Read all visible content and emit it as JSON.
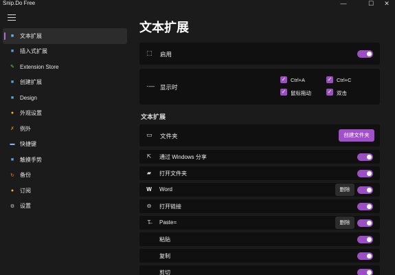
{
  "window": {
    "title": "Snip.Do Free",
    "minimize": "—",
    "maximize": "☐",
    "close": "✕"
  },
  "sidebar": {
    "items": [
      {
        "label": "文本扩展",
        "icon": "text-expand-icon",
        "color": "#6fb3e8",
        "glyph": "■"
      },
      {
        "label": "插入式扩展",
        "icon": "insert-expand-icon",
        "color": "#5aa0e0",
        "glyph": "■"
      },
      {
        "label": "Extension Store",
        "icon": "store-icon",
        "color": "#7ac943",
        "glyph": "✎"
      },
      {
        "label": "创建扩展",
        "icon": "create-expand-icon",
        "color": "#5aa0e0",
        "glyph": "■"
      },
      {
        "label": "Design",
        "icon": "design-icon",
        "color": "#5aa0e0",
        "glyph": "■"
      },
      {
        "label": "外观设置",
        "icon": "appearance-icon",
        "color": "#f0b429",
        "glyph": "●"
      },
      {
        "label": "例外",
        "icon": "exception-icon",
        "color": "#f07a29",
        "glyph": "✗"
      },
      {
        "label": "快捷键",
        "icon": "keyboard-icon",
        "color": "#8ab4e8",
        "glyph": "▬"
      },
      {
        "label": "触摸手势",
        "icon": "gesture-icon",
        "color": "#5aa0e0",
        "glyph": "■"
      },
      {
        "label": "备份",
        "icon": "backup-icon",
        "color": "#f07a29",
        "glyph": "↻"
      },
      {
        "label": "订阅",
        "icon": "subscribe-icon",
        "color": "#f0b429",
        "glyph": "●"
      },
      {
        "label": "设置",
        "icon": "settings-icon",
        "color": "#cccccc",
        "glyph": "⚙"
      }
    ]
  },
  "main": {
    "title": "文本扩展",
    "enable": {
      "label": "启用",
      "on": true
    },
    "display": {
      "label": "显示时",
      "options": [
        {
          "label": "Ctrl+A",
          "checked": true
        },
        {
          "label": "Ctrl+C",
          "checked": true
        },
        {
          "label": "鼠标拖动",
          "checked": true
        },
        {
          "label": "双击",
          "checked": true
        }
      ]
    },
    "section_title": "文本扩展",
    "folder": {
      "label": "文件夹",
      "create_label": "创建文件夹"
    },
    "extensions": [
      {
        "label": "通过 Windows 分享",
        "icon": "share-icon",
        "glyph": "⇱",
        "delete": false,
        "on": true
      },
      {
        "label": "打开文件夹",
        "icon": "folder-icon",
        "glyph": "▰",
        "delete": false,
        "on": true
      },
      {
        "label": "Word",
        "icon": "word-icon",
        "glyph": "W",
        "delete": true,
        "on": true
      },
      {
        "label": "打开链接",
        "icon": "link-icon",
        "glyph": "⊖",
        "delete": false,
        "on": true
      },
      {
        "label": "Paste=",
        "icon": "paste-format-icon",
        "glyph": "T̶",
        "delete": true,
        "on": true
      },
      {
        "label": "粘贴",
        "icon": "",
        "glyph": "",
        "delete": false,
        "on": true
      },
      {
        "label": "复制",
        "icon": "",
        "glyph": "",
        "delete": false,
        "on": true
      },
      {
        "label": "剪切",
        "icon": "",
        "glyph": "",
        "delete": false,
        "on": true
      }
    ],
    "delete_label": "删除"
  }
}
